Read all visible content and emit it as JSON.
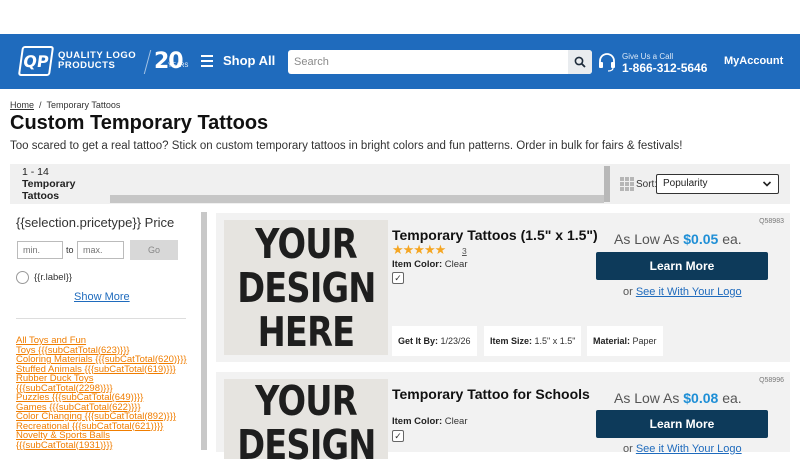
{
  "header": {
    "logo_mark": "QP",
    "logo_line1": "QUALITY LOGO",
    "logo_line2": "PRODUCTS",
    "anniversary_number": "20",
    "anniversary_sub": "YEARS",
    "shop_all": "Shop All",
    "search_placeholder": "Search",
    "call_label": "Give Us a Call",
    "call_number": "1-866-312-5646",
    "account": "MyAccount",
    "brand_color": "#1f6bbd"
  },
  "breadcrumb": {
    "home": "Home",
    "separator": "/",
    "current": "Temporary Tattoos"
  },
  "page": {
    "title": "Custom Temporary Tattoos",
    "description": "Too scared to get a real tattoo? Stick on custom temporary tattoos in bright colors and fun patterns. Order in bulk for fairs & festivals!"
  },
  "sortbar": {
    "range": "1 - 14",
    "category_line1": "Temporary",
    "category_line2": "Tattoos",
    "sort_label": "Sort:",
    "sort_value": "Popularity"
  },
  "filters": {
    "price_title": "{{selection.pricetype}} Price",
    "min_placeholder": "min.",
    "to": "to",
    "max_placeholder": "max.",
    "go": "Go",
    "radio_label": "{{r.label}}",
    "show_more": "Show More",
    "categories": [
      "All Toys and Fun",
      "Toys {{{subCatTotal(623)}}}",
      "Coloring Materials {{{subCatTotal(620)}}}",
      "Stuffed Animals {{{subCatTotal(619)}}}",
      "Rubber Duck Toys",
      "{{{subCatTotal(2298)}}}",
      "Puzzles {{{subCatTotal(649)}}}",
      "Games {{{subCatTotal(622)}}}",
      "Color Changing {{{subCatTotal(892)}}}",
      "Recreational {{{subCatTotal(621)}}}",
      "Novelty & Sports Balls",
      "{{{subCatTotal(1931)}}}"
    ]
  },
  "products": [
    {
      "sku": "Q58983",
      "image_words": [
        "YOUR",
        "DESIGN",
        "HERE"
      ],
      "name": "Temporary Tattoos (1.5\" x 1.5\")",
      "stars": "★★★★★",
      "rating": 5,
      "reviews": "3",
      "item_color_label": "Item Color:",
      "item_color": "Clear",
      "price_prefix": "As Low As",
      "price": "$0.05",
      "price_suffix": "ea.",
      "cta": "Learn More",
      "or": "or",
      "see_logo": "See it With Your Logo",
      "get_it_by_label": "Get It By:",
      "get_it_by": "1/23/26",
      "item_size_label": "Item Size:",
      "item_size": "1.5\" x 1.5\"",
      "material_label": "Material:",
      "material": "Paper"
    },
    {
      "sku": "Q58996",
      "image_words": [
        "YOUR",
        "DESIGN"
      ],
      "name": "Temporary Tattoo for Schools",
      "item_color_label": "Item Color:",
      "item_color": "Clear",
      "price_prefix": "As Low As",
      "price": "$0.08",
      "price_suffix": "ea.",
      "cta": "Learn More",
      "or": "or",
      "see_logo": "See it With Your Logo"
    }
  ]
}
